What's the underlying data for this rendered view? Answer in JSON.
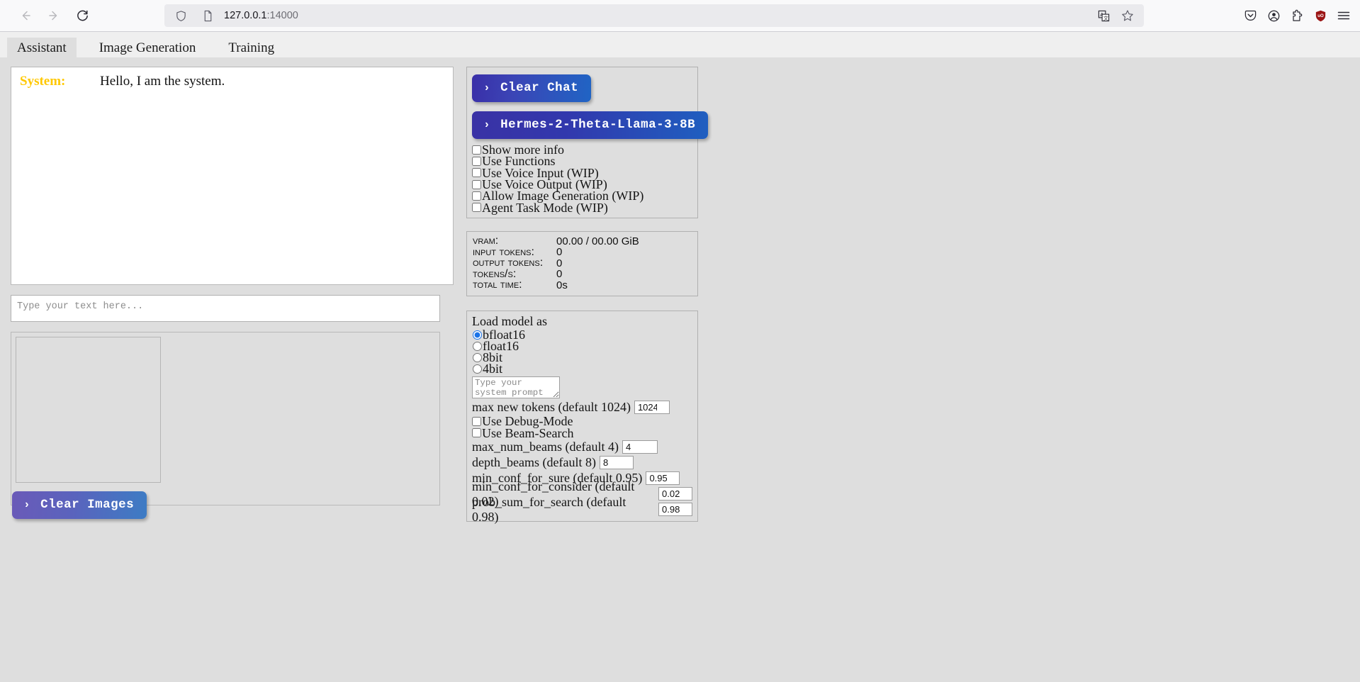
{
  "browser": {
    "url_host": "127.0.0.1",
    "url_port": ":14000",
    "back_icon": "back-arrow-icon",
    "forward_icon": "forward-arrow-icon",
    "reload_icon": "reload-icon",
    "shield_icon": "shield-icon",
    "page_icon": "page-icon",
    "translate_icon": "translate-icon",
    "bookmark_icon": "star-icon",
    "pocket_icon": "pocket-icon",
    "account_icon": "account-icon",
    "extensions_icon": "extensions-icon",
    "ublock_icon": "ublock-origin-icon",
    "menu_icon": "hamburger-menu-icon"
  },
  "tabs": [
    {
      "label": "Assistant",
      "active": true
    },
    {
      "label": "Image Generation",
      "active": false
    },
    {
      "label": "Training",
      "active": false
    }
  ],
  "chat": {
    "speaker": "System:",
    "message": "Hello, I am the system.",
    "speaker_color": "#ffc800"
  },
  "text_input": {
    "placeholder": "Type your text here...",
    "value": ""
  },
  "images": {
    "clear_label": "Clear Images",
    "chevron": "›"
  },
  "actions": {
    "clear_chat_label": "Clear Chat",
    "model_label": "Hermes-2-Theta-Llama-3-8B",
    "chevron": "›"
  },
  "options": [
    {
      "label": "Show more info",
      "checked": false
    },
    {
      "label": "Use Functions",
      "checked": false
    },
    {
      "label": "Use Voice Input (WIP)",
      "checked": false
    },
    {
      "label": "Use Voice Output (WIP)",
      "checked": false
    },
    {
      "label": "Allow Image Generation (WIP)",
      "checked": false
    },
    {
      "label": "Agent Task Mode (WIP)",
      "checked": false
    }
  ],
  "stats": [
    {
      "label": "Vram:",
      "value": "00.00 / 00.00 GiB"
    },
    {
      "label": "Input Tokens:",
      "value": "0"
    },
    {
      "label": "Output Tokens:",
      "value": "0"
    },
    {
      "label": "Tokens/s:",
      "value": "0"
    },
    {
      "label": "Total Time:",
      "value": "0s"
    }
  ],
  "load_model": {
    "title": "Load model as",
    "selected": "bfloat16",
    "choices": [
      {
        "label": "bfloat16",
        "checked": true
      },
      {
        "label": "float16",
        "checked": false
      },
      {
        "label": "8bit",
        "checked": false
      },
      {
        "label": "4bit",
        "checked": false
      }
    ],
    "system_prompt": {
      "placeholder": "Type your system prompt here...",
      "value": ""
    }
  },
  "params": {
    "max_new_tokens": {
      "label": "max new tokens (default 1024)",
      "value": "1024"
    },
    "use_debug_mode": {
      "label": "Use Debug-Mode",
      "checked": false
    },
    "use_beam_search": {
      "label": "Use Beam-Search",
      "checked": false
    },
    "max_num_beams": {
      "label": "max_num_beams (default 4)",
      "value": "4"
    },
    "depth_beams": {
      "label": "depth_beams (default 8)",
      "value": "8"
    },
    "min_conf_for_sure": {
      "label": "min_conf_for_sure (default 0.95)",
      "value": "0.95"
    },
    "min_conf_for_consider": {
      "label": "min_conf_for_consider (default 0.02)",
      "value": "0.02"
    },
    "prob_sum_for_search": {
      "label": "prob_sum_for_search (default 0.98)",
      "value": "0.98"
    }
  },
  "colors": {
    "background": "#dedede",
    "accent_blue": "#2064c4",
    "accent_indigo": "#3a2fa8",
    "system_gold": "#ffc800"
  }
}
